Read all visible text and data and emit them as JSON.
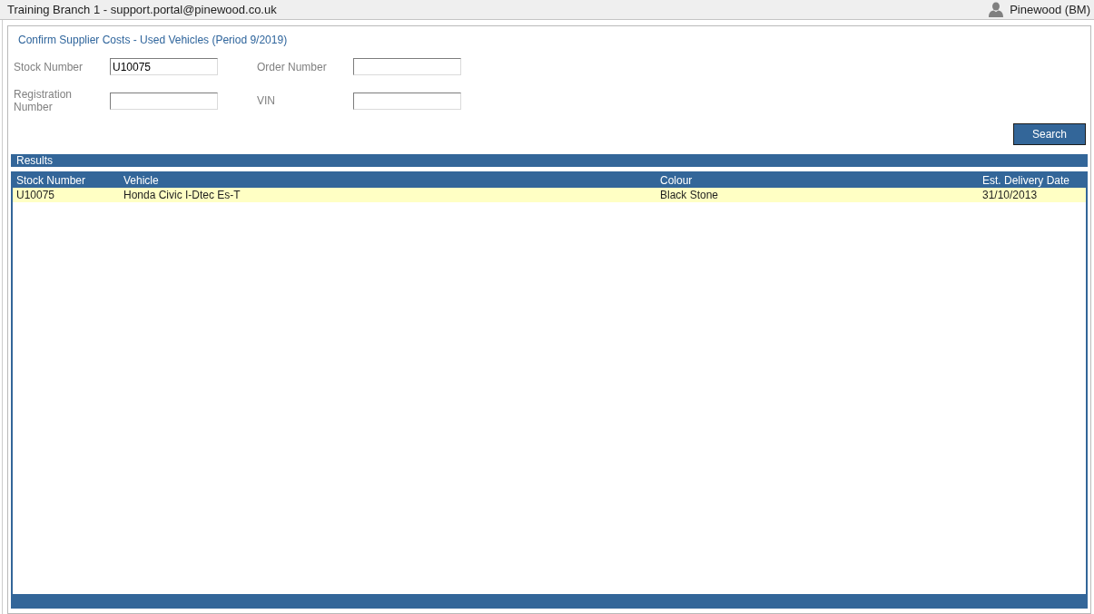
{
  "top_bar": {
    "branch_user": "Training Branch 1 - support.portal@pinewood.co.uk",
    "account": "Pinewood (BM)"
  },
  "page_title": "Confirm Supplier Costs - Used Vehicles (Period 9/2019)",
  "search_form": {
    "fields": [
      {
        "label": "Stock Number",
        "value": "U10075"
      },
      {
        "label": "Order Number"
      },
      {
        "label": "Registration Number"
      },
      {
        "label": "VIN"
      }
    ],
    "search_button": "Search"
  },
  "results": {
    "title": "Results",
    "columns": [
      "Stock Number",
      "Vehicle",
      "Colour",
      "Est. Delivery Date"
    ],
    "rows": [
      {
        "selected": true,
        "cells": [
          "U10075",
          "Honda Civic I-Dtec Es-T",
          "Black Stone",
          "31/10/2013"
        ]
      }
    ]
  }
}
